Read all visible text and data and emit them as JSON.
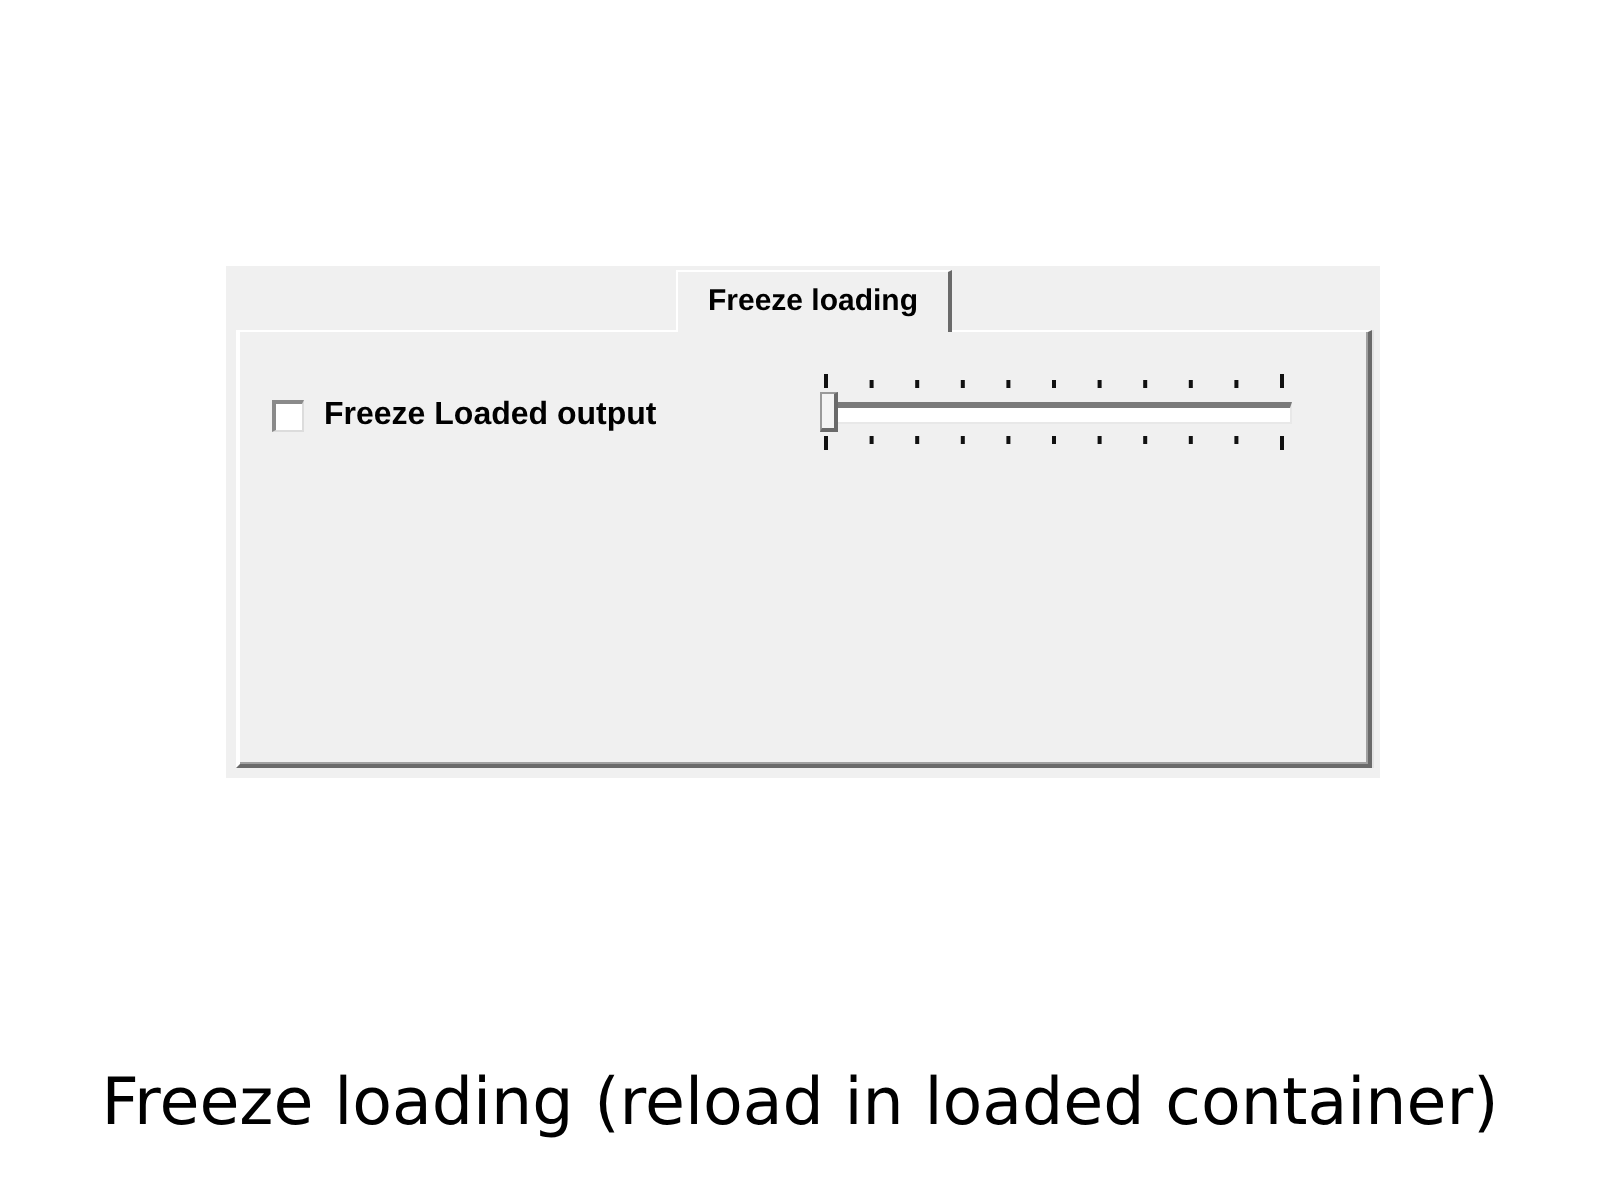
{
  "tabs": [
    {
      "label": "Freeze loading",
      "selected": true
    }
  ],
  "panel": {
    "checkbox": {
      "label": "Freeze Loaded output",
      "checked": false
    },
    "slider": {
      "level": 0
    }
  },
  "caption": "Freeze loading (reload in loaded container)"
}
